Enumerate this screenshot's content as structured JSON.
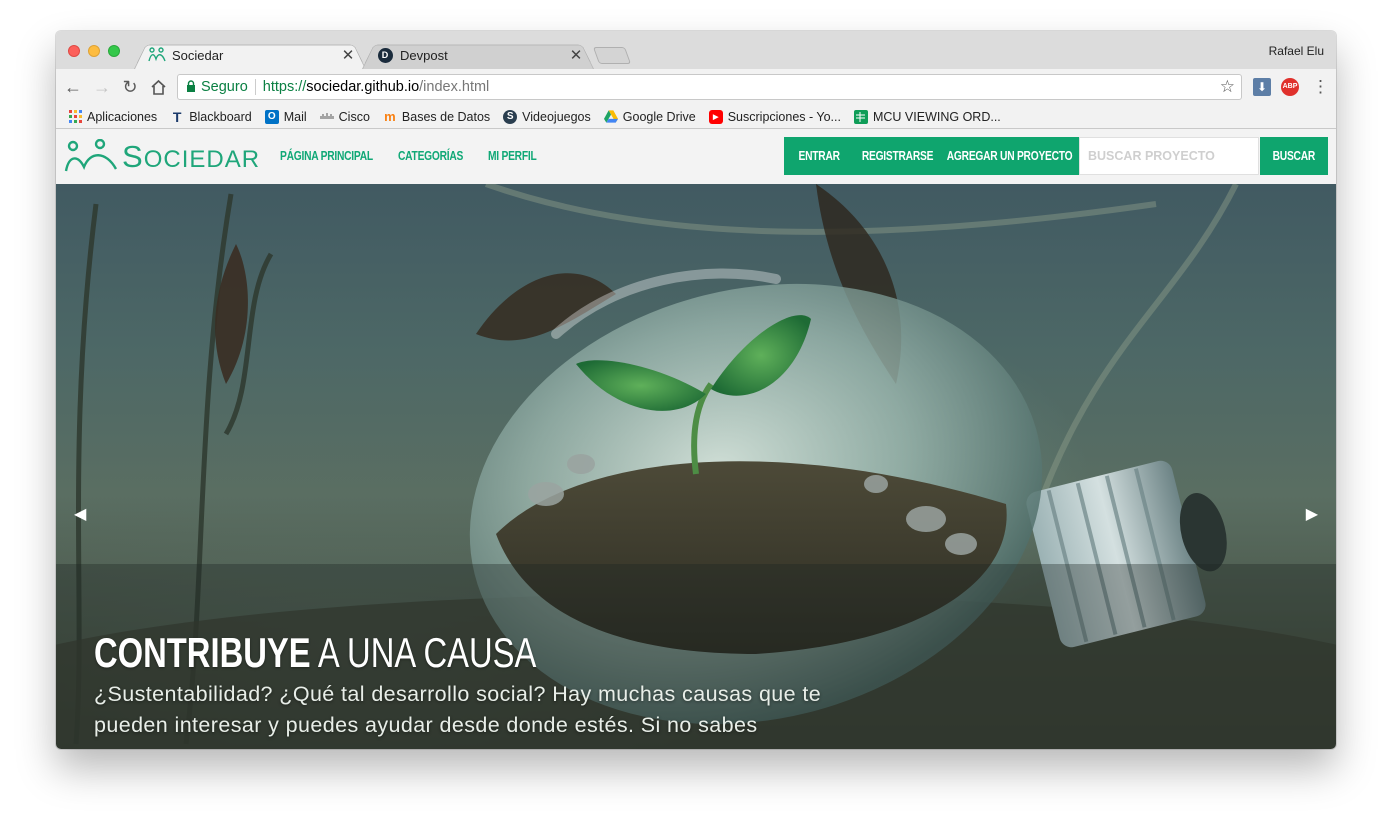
{
  "browser": {
    "tabs": [
      {
        "title": "Sociedar",
        "active": true
      },
      {
        "title": "Devpost",
        "active": false
      }
    ],
    "profile_name": "Rafael Elu",
    "address": {
      "secure_label": "Seguro",
      "scheme": "https://",
      "host": "sociedar.github.io",
      "path": "/index.html"
    },
    "bookmarks": [
      {
        "label": "Aplicaciones",
        "icon": "apps-grid-icon",
        "color": "#e8453c"
      },
      {
        "label": "Blackboard",
        "icon": "blackboard-icon",
        "color": "#1b3a6b"
      },
      {
        "label": "Mail",
        "icon": "outlook-icon",
        "color": "#0072c6"
      },
      {
        "label": "Cisco",
        "icon": "cisco-icon",
        "color": "#1ba0d7"
      },
      {
        "label": "Bases de Datos",
        "icon": "moodle-icon",
        "color": "#f98012"
      },
      {
        "label": "Videojuegos",
        "icon": "s-circle-icon",
        "color": "#2a3e4f"
      },
      {
        "label": "Google Drive",
        "icon": "google-drive-icon",
        "color": "#1fa463"
      },
      {
        "label": "Suscripciones - Yo...",
        "icon": "youtube-icon",
        "color": "#ff0000"
      },
      {
        "label": "MCU VIEWING ORD...",
        "icon": "sheets-icon",
        "color": "#0f9d58"
      }
    ]
  },
  "site": {
    "logo_initial": "S",
    "logo_rest": "OCIEDAR",
    "nav_links": [
      "PÁGINA PRINCIPAL",
      "CATEGORÍAS",
      "MI PERFIL"
    ],
    "buttons": {
      "login": "ENTRAR",
      "register": "REGISTRARSE",
      "add_project": "AGREGAR UN PROYECTO",
      "search": "BUSCAR"
    },
    "search_placeholder": "BUSCAR PROYECTO",
    "accent_color": "#0fa56e"
  },
  "hero": {
    "title_bold": "CONTRIBUYE",
    "title_rest": " A UNA CAUSA",
    "text": "¿Sustentabilidad? ¿Qué tal desarrollo social? Hay muchas causas que te pueden interesar y puedes ayudar desde donde estés. Si no sabes"
  }
}
